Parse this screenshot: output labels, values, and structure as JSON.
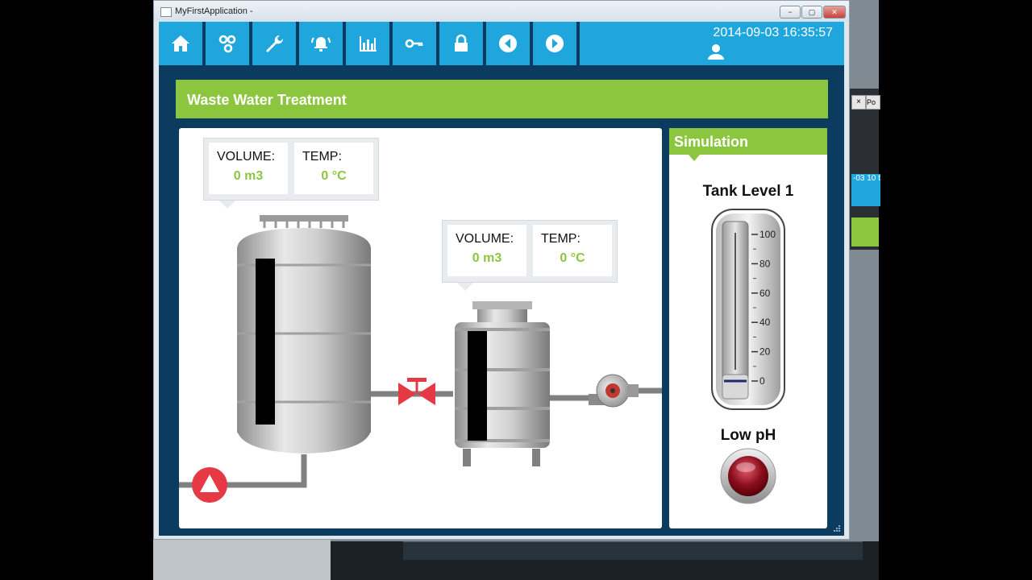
{
  "window": {
    "title": "MyFirstApplication -",
    "buttons": {
      "minimize": "−",
      "maximize": "▢",
      "close": "✕"
    }
  },
  "toolbar": {
    "items": [
      {
        "name": "home",
        "icon": "home-icon"
      },
      {
        "name": "overview",
        "icon": "process-icon"
      },
      {
        "name": "settings",
        "icon": "wrench-icon"
      },
      {
        "name": "alarms",
        "icon": "alarm-icon"
      },
      {
        "name": "trends",
        "icon": "bar-chart-icon"
      },
      {
        "name": "login",
        "icon": "key-icon"
      },
      {
        "name": "lock",
        "icon": "lock-icon"
      },
      {
        "name": "back",
        "icon": "arrow-left-icon"
      },
      {
        "name": "forward",
        "icon": "arrow-right-icon"
      }
    ],
    "datetime": "2014-09-03 16:35:57",
    "user_icon": "user-icon"
  },
  "header": {
    "title": "Waste Water Treatment"
  },
  "process": {
    "tank1": {
      "volume_label": "VOLUME:",
      "volume_value": "0 m3",
      "temp_label": "TEMP:",
      "temp_value": "0 °C",
      "level": 0
    },
    "tank2": {
      "volume_label": "VOLUME:",
      "volume_value": "0 m3",
      "temp_label": "TEMP:",
      "temp_value": "0 °C",
      "level": 0
    },
    "valve_icon": "valve-icon",
    "pump_icon": "pump-icon",
    "inlet_pump_icon": "triangle-pump-icon"
  },
  "simulation": {
    "title": "Simulation",
    "tank_level_label": "Tank Level 1",
    "gauge_ticks": [
      "100",
      "80",
      "60",
      "40",
      "20",
      "0"
    ],
    "tank_level_value": 0,
    "low_ph_label": "Low pH",
    "low_ph_active": false
  },
  "background": {
    "tab1": "×",
    "tab2": "Po",
    "blue_text": "-03 10\nt"
  },
  "colors": {
    "accent": "#1fa7dd",
    "green": "#8cc63f",
    "navy": "#0b3b5e",
    "alarm": "#e63946"
  }
}
